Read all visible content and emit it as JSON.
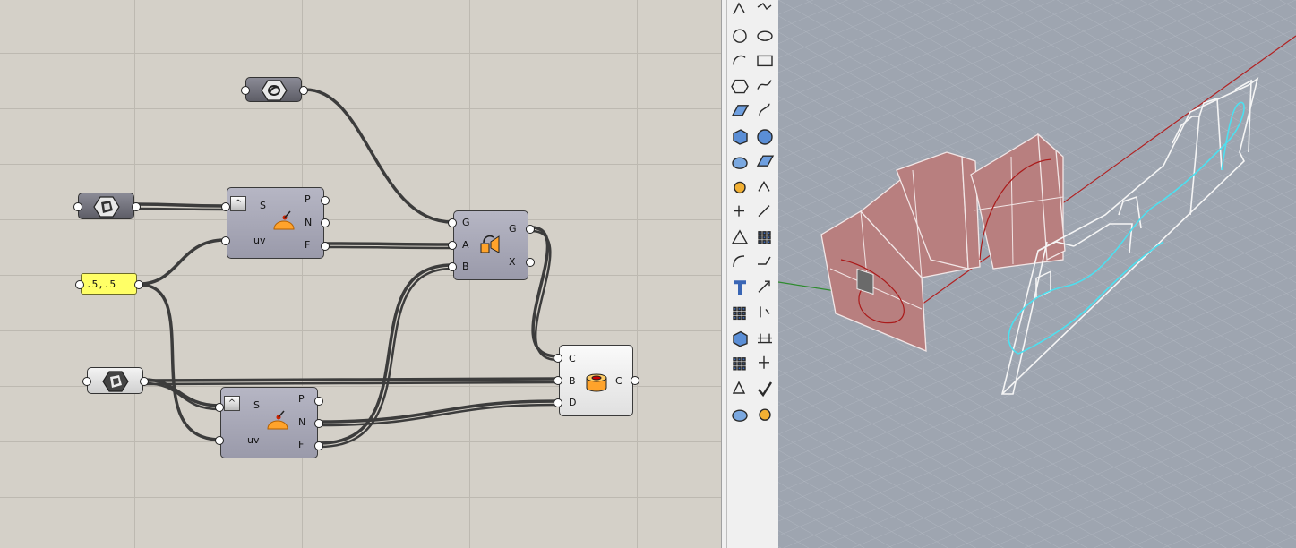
{
  "canvas": {
    "panel": {
      "value": ".5,.5"
    },
    "brep_param_1": {
      "icon": "brep-icon"
    },
    "brep_param_2": {
      "icon": "brep-icon"
    },
    "curve_param": {
      "icon": "curve-icon"
    },
    "evaluate_1": {
      "icon": "evaluate-surface-icon",
      "inputs": [
        "S",
        "uv"
      ],
      "outputs": [
        "P",
        "N",
        "F"
      ],
      "badge": "^"
    },
    "evaluate_2": {
      "icon": "evaluate-surface-icon",
      "inputs": [
        "S",
        "uv"
      ],
      "outputs": [
        "P",
        "N",
        "F"
      ],
      "badge": "^"
    },
    "orient": {
      "icon": "orient-icon",
      "inputs": [
        "G",
        "A",
        "B"
      ],
      "outputs": [
        "G",
        "X"
      ]
    },
    "collect": {
      "icon": "boolean-icon",
      "inputs": [
        "C",
        "B",
        "D"
      ],
      "outputs": [
        "C"
      ]
    }
  },
  "colors": {
    "canvas_bg": "#d4d0c8",
    "wire": "#3c3c3c",
    "panel_bg": "#ffff66",
    "surface_fill": "#b87f7f",
    "viewport_bg": "#9ea5b0",
    "highlight_curve": "#4ce0f0",
    "x_axis": "#b22222",
    "y_axis": "#2e8b2e"
  },
  "toolbar": {
    "icons": [
      "point-icon",
      "polyline-icon",
      "circle-icon",
      "ellipse-icon",
      "arc-icon",
      "rectangle-icon",
      "polygon-icon",
      "curve-icon",
      "surface-icon",
      "revolve-icon",
      "box-icon",
      "sphere-icon",
      "cylinder-icon",
      "mesh-icon",
      "gear-icon",
      "explode-icon",
      "trim-icon",
      "split-icon",
      "boolean-union-icon",
      "boolean-split-icon",
      "fillet-icon",
      "offset-icon",
      "text-icon",
      "scale-icon",
      "array-icon",
      "align-icon",
      "block-icon",
      "dimension-icon",
      "grid-icon",
      "gumball-icon",
      "layer-icon",
      "check-icon",
      "shade-icon",
      "render-icon"
    ]
  }
}
